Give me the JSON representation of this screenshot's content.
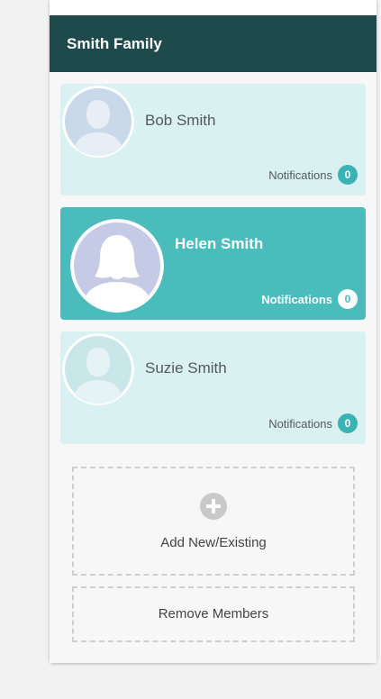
{
  "family": {
    "title": "Smith Family"
  },
  "members": [
    {
      "name": "Bob Smith",
      "notifications_label": "Notifications",
      "notifications_count": "0",
      "selected": false,
      "avatar_icon": "person-silhouette-icon"
    },
    {
      "name": "Helen Smith",
      "notifications_label": "Notifications",
      "notifications_count": "0",
      "selected": true,
      "avatar_icon": "female-silhouette-icon"
    },
    {
      "name": "Suzie Smith",
      "notifications_label": "Notifications",
      "notifications_count": "0",
      "selected": false,
      "avatar_icon": "person-silhouette-icon"
    }
  ],
  "actions": {
    "add_label": "Add New/Existing",
    "add_icon": "plus-circle-icon",
    "remove_label": "Remove Members"
  },
  "colors": {
    "header_bg": "#1f4a4c",
    "card_bg": "#d9f1f0",
    "card_selected_bg": "#4bbcbc",
    "badge_bg": "#3bb3b4"
  }
}
